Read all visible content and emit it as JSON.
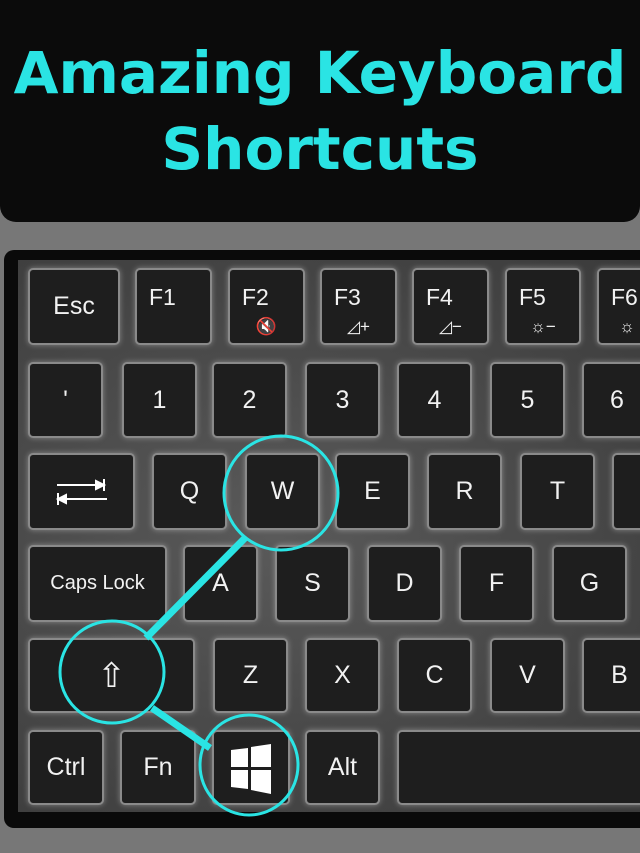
{
  "title": "Amazing Keyboard Shortcuts",
  "accent": "#2ae4e4",
  "keys": {
    "row1": [
      "Esc",
      "F1",
      "F2",
      "F3",
      "F4",
      "F5",
      "F6"
    ],
    "row1_sub": [
      "",
      "",
      "🔇",
      "◿+",
      "◿−",
      "☼−",
      "☼"
    ],
    "row2": [
      "'",
      "1",
      "2",
      "3",
      "4",
      "5",
      "6"
    ],
    "row3": [
      "Q",
      "W",
      "E",
      "R",
      "T"
    ],
    "row4": [
      "Caps Lock",
      "A",
      "S",
      "D",
      "F",
      "G"
    ],
    "row5": [
      "⇧",
      "Z",
      "X",
      "C",
      "V",
      "B"
    ],
    "row6": [
      "Ctrl",
      "Fn",
      "Alt"
    ]
  },
  "highlighted": [
    "windows-key",
    "shift-key",
    "W"
  ]
}
